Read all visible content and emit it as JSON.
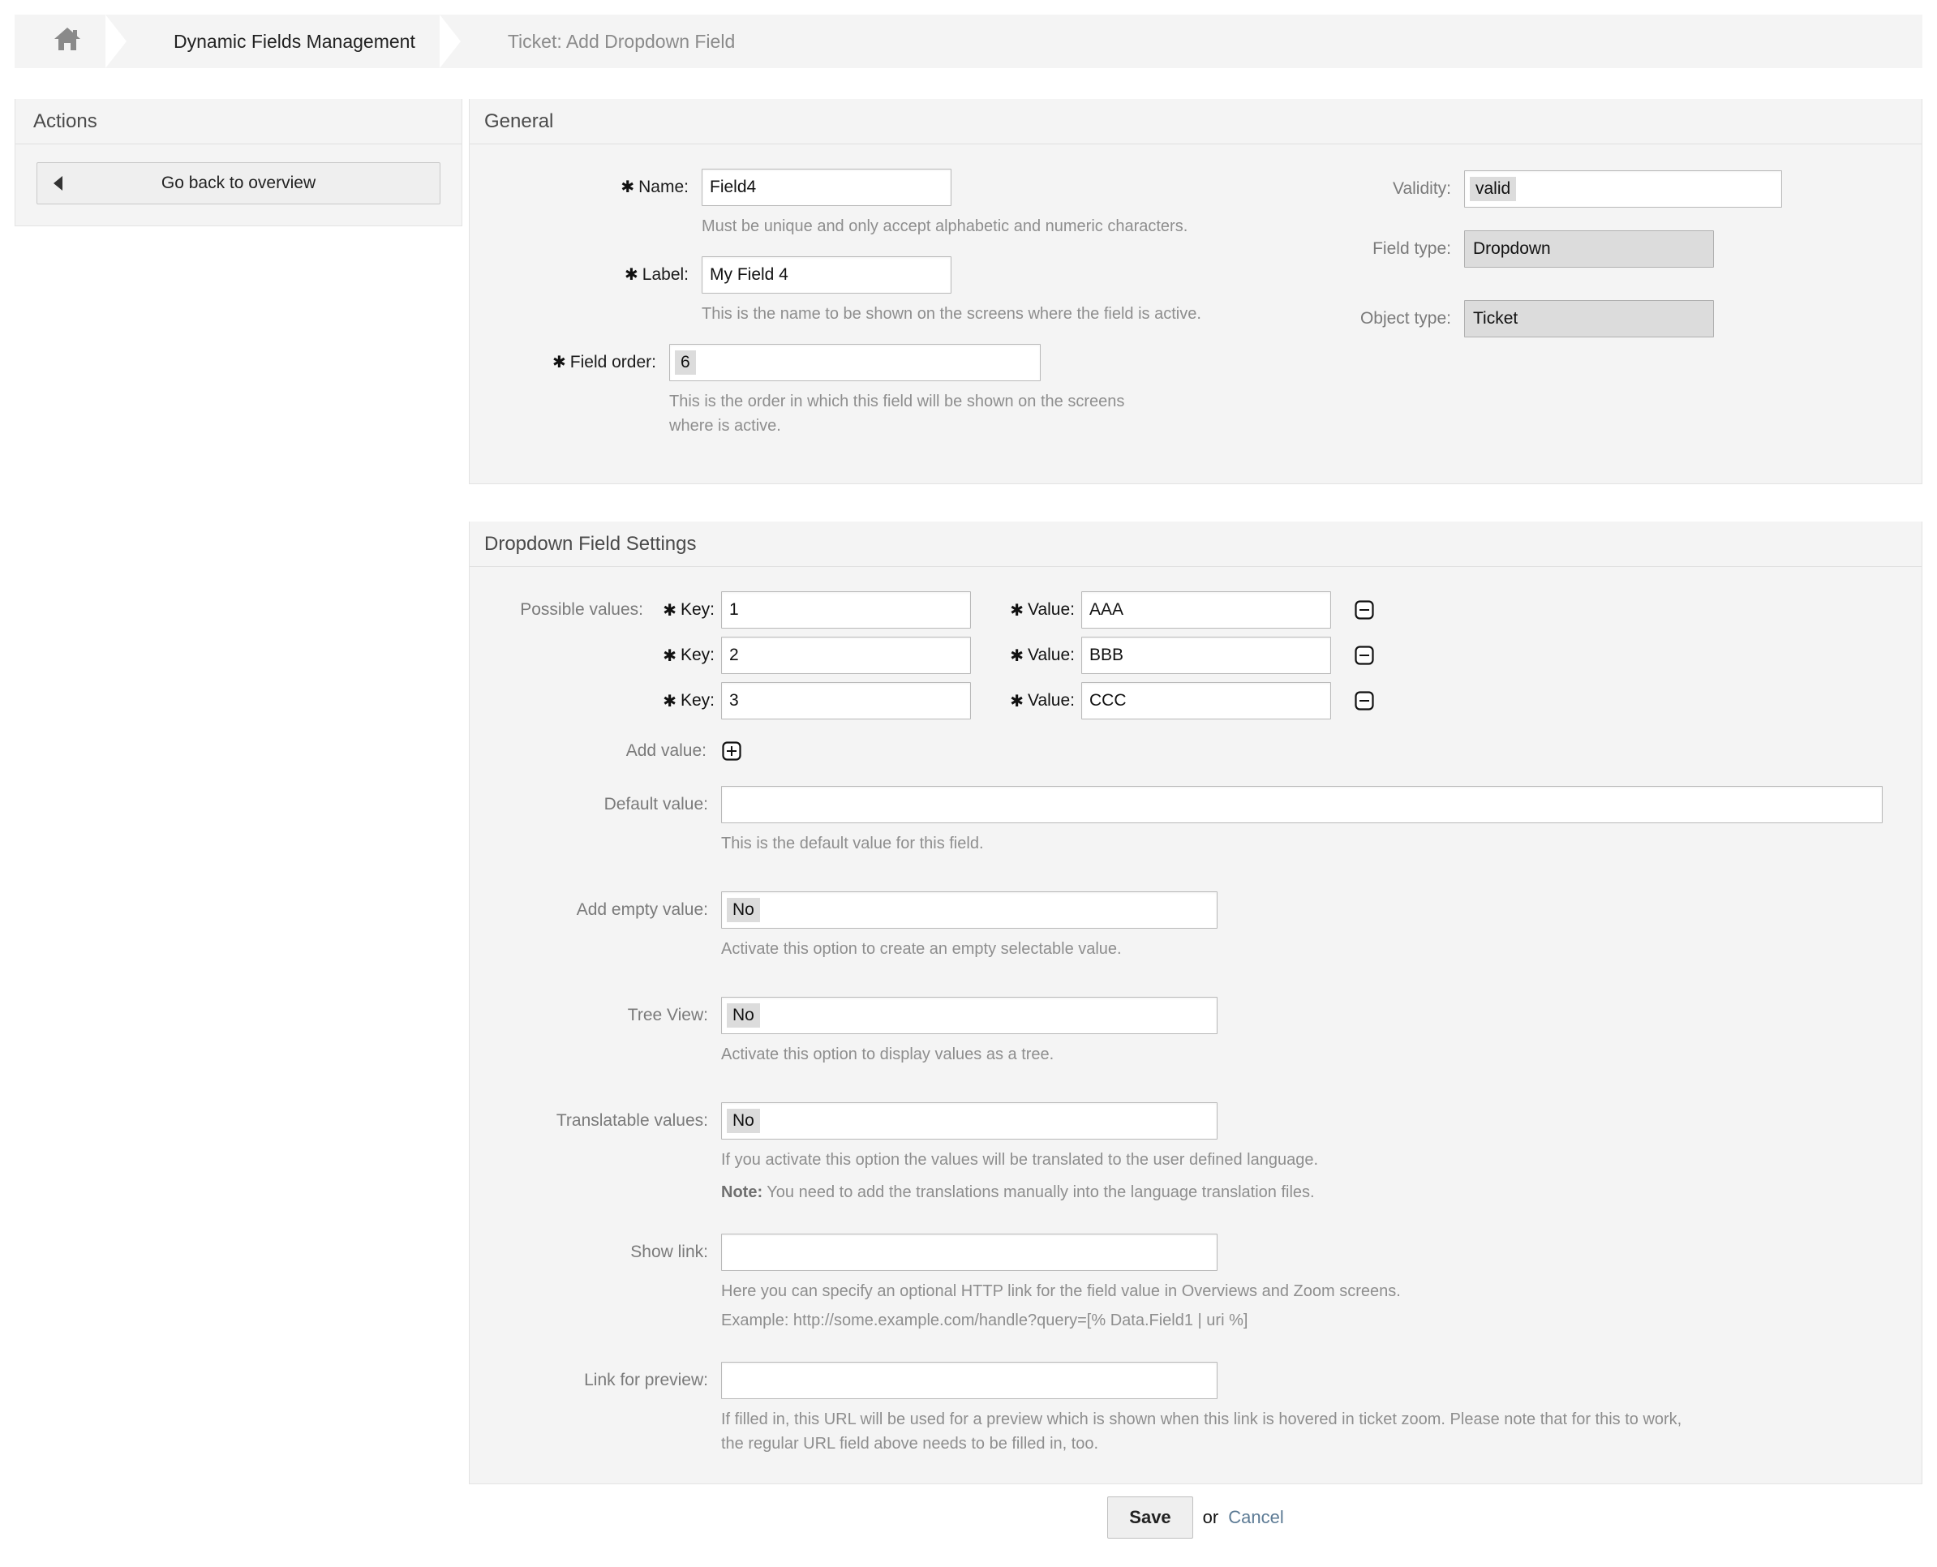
{
  "breadcrumb": {
    "home_icon": "home-icon",
    "items": [
      {
        "label": "Dynamic Fields Management",
        "muted": false
      },
      {
        "label": "Ticket: Add Dropdown Field",
        "muted": true
      }
    ]
  },
  "sidebar": {
    "title": "Actions",
    "go_back_label": "Go back to overview"
  },
  "general": {
    "title": "General",
    "name": {
      "label": "Name:",
      "value": "Field4",
      "hint": "Must be unique and only accept alphabetic and numeric characters."
    },
    "field_label": {
      "label": "Label:",
      "value": "My Field 4",
      "hint": "This is the name to be shown on the screens where the field is active."
    },
    "field_order": {
      "label": "Field order:",
      "value": "6",
      "hint": "This is the order in which this field will be shown on the screens where is active."
    },
    "validity": {
      "label": "Validity:",
      "value": "valid"
    },
    "field_type": {
      "label": "Field type:",
      "value": "Dropdown"
    },
    "object_type": {
      "label": "Object type:",
      "value": "Ticket"
    }
  },
  "dropdown_settings": {
    "title": "Dropdown Field Settings",
    "possible_values": {
      "label": "Possible values:",
      "key_label": "Key:",
      "value_label": "Value:",
      "rows": [
        {
          "key": "1",
          "value": "AAA"
        },
        {
          "key": "2",
          "value": "BBB"
        },
        {
          "key": "3",
          "value": "CCC"
        }
      ],
      "remove_icon": "minus-square-icon"
    },
    "add_value": {
      "label": "Add value:",
      "icon": "plus-square-icon"
    },
    "default_value": {
      "label": "Default value:",
      "value": "",
      "hint": "This is the default value for this field."
    },
    "add_empty_value": {
      "label": "Add empty value:",
      "value": "No",
      "hint": "Activate this option to create an empty selectable value."
    },
    "tree_view": {
      "label": "Tree View:",
      "value": "No",
      "hint": "Activate this option to display values as a tree."
    },
    "translatable_values": {
      "label": "Translatable values:",
      "value": "No",
      "hint": "If you activate this option the values will be translated to the user defined language.",
      "note_prefix": "Note:",
      "note": " You need to add the translations manually into the language translation files."
    },
    "show_link": {
      "label": "Show link:",
      "value": "",
      "hint_line1": "Here you can specify an optional HTTP link for the field value in Overviews and Zoom screens.",
      "hint_line2": "Example: http://some.example.com/handle?query=[% Data.Field1 | uri %]"
    },
    "link_for_preview": {
      "label": "Link for preview:",
      "value": "",
      "hint": "If filled in, this URL will be used for a preview which is shown when this link is hovered in ticket zoom. Please note that for this to work, the regular URL field above needs to be filled in, too."
    }
  },
  "footer": {
    "save_label": "Save",
    "or_label": "or",
    "cancel_label": "Cancel"
  },
  "colors": {
    "panel_bg": "#f4f4f4",
    "link": "#5d7b95",
    "hint_text": "#8e8e8e"
  }
}
